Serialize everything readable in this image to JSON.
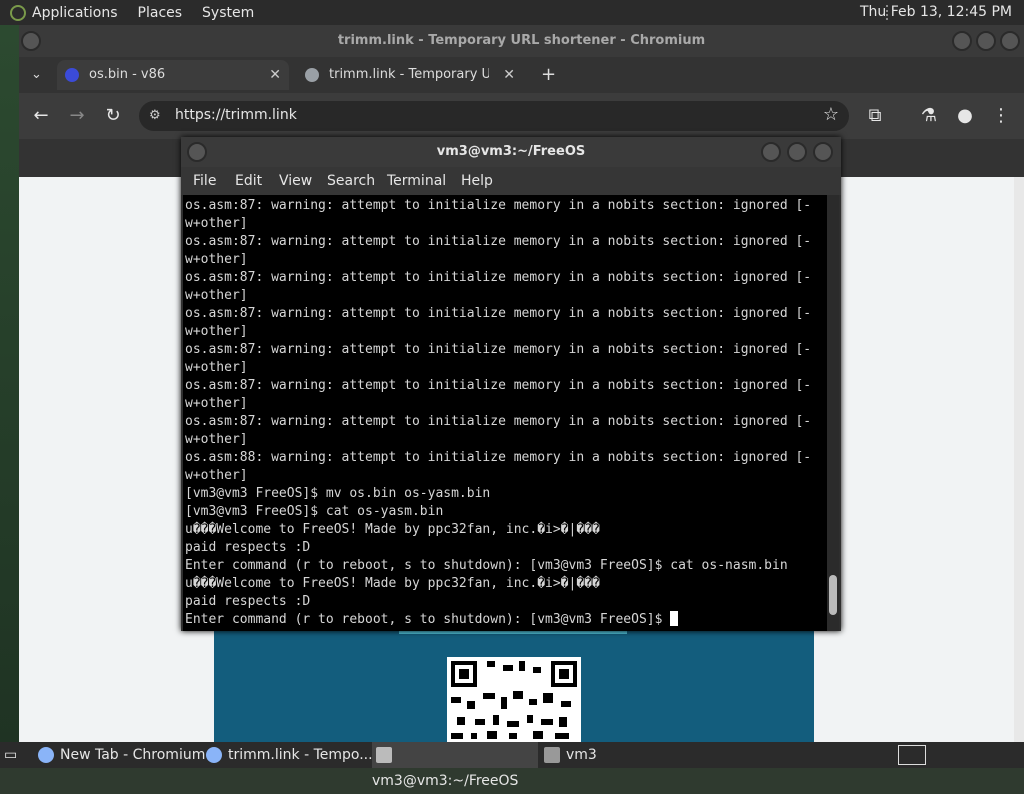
{
  "top_panel": {
    "menu": [
      "Applications",
      "Places",
      "System"
    ],
    "clock": "Thu Feb 13, 12:45 PM"
  },
  "browser": {
    "title": "trimm.link - Temporary URL shortener - Chromium",
    "tabs": [
      {
        "label": "os.bin - v86",
        "close": "✕"
      },
      {
        "label": "trimm.link - Temporary URL shortener",
        "close": "✕"
      }
    ],
    "new_tab": "+",
    "url": "https://trimm.link",
    "icons": {
      "back": "arrow-left-icon",
      "forward": "arrow-right-icon",
      "reload": "reload-icon",
      "star": "star-icon",
      "extensions": "puzzle-icon",
      "labs": "flask-icon",
      "profile": "person-icon",
      "menu": "kebab-menu-icon"
    }
  },
  "terminal": {
    "title": "vm3@vm3:~/FreeOS",
    "menu": [
      "File",
      "Edit",
      "View",
      "Search",
      "Terminal",
      "Help"
    ],
    "lines": [
      "os.asm:87: warning: attempt to initialize memory in a nobits section: ignored [-",
      "w+other]",
      "os.asm:87: warning: attempt to initialize memory in a nobits section: ignored [-",
      "w+other]",
      "os.asm:87: warning: attempt to initialize memory in a nobits section: ignored [-",
      "w+other]",
      "os.asm:87: warning: attempt to initialize memory in a nobits section: ignored [-",
      "w+other]",
      "os.asm:87: warning: attempt to initialize memory in a nobits section: ignored [-",
      "w+other]",
      "os.asm:87: warning: attempt to initialize memory in a nobits section: ignored [-",
      "w+other]",
      "os.asm:87: warning: attempt to initialize memory in a nobits section: ignored [-",
      "w+other]",
      "os.asm:88: warning: attempt to initialize memory in a nobits section: ignored [-",
      "w+other]",
      "[vm3@vm3 FreeOS]$ mv os.bin os-yasm.bin",
      "[vm3@vm3 FreeOS]$ cat os-yasm.bin",
      "u���Welcome to FreeOS! Made by ppc32fan, inc.�i>�|���",
      "paid respects :D",
      "Enter command (r to reboot, s to shutdown): [vm3@vm3 FreeOS]$ cat os-nasm.bin",
      "u���Welcome to FreeOS! Made by ppc32fan, inc.�i>�|���",
      "paid respects :D"
    ],
    "prompt": "Enter command (r to reboot, s to shutdown): [vm3@vm3 FreeOS]$ "
  },
  "taskbar": {
    "items": [
      "New Tab - Chromium",
      "trimm.link - Tempo...",
      "vm3@vm3:~/FreeOS",
      "vm3"
    ]
  }
}
